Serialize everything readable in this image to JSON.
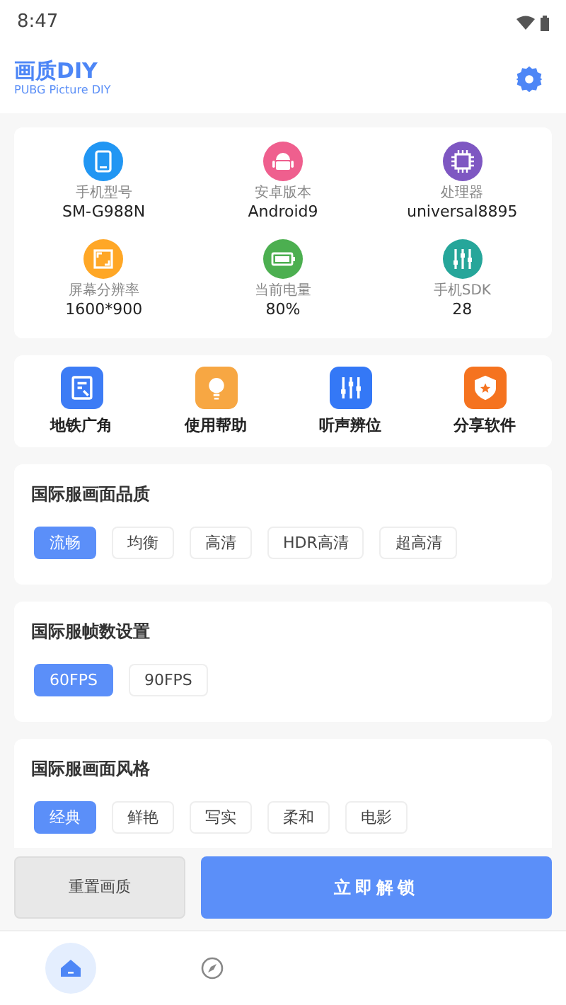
{
  "status_bar": {
    "time": "8:47"
  },
  "header": {
    "title": "画质DIY",
    "subtitle": "PUBG Picture DIY"
  },
  "device_info": [
    {
      "kind": "phone",
      "label": "手机型号",
      "value": "SM-G988N",
      "color": "#2196f3"
    },
    {
      "kind": "android",
      "label": "安卓版本",
      "value": "Android9",
      "color": "#ef5f8e"
    },
    {
      "kind": "chip",
      "label": "处理器",
      "value": "universal8895",
      "color": "#7e57c2"
    },
    {
      "kind": "screen",
      "label": "屏幕分辨率",
      "value": "1600*900",
      "color": "#ffa726"
    },
    {
      "kind": "battery",
      "label": "当前电量",
      "value": "80%",
      "color": "#4caf50"
    },
    {
      "kind": "sliders",
      "label": "手机SDK",
      "value": "28",
      "color": "#26a69a"
    }
  ],
  "tools": [
    {
      "kind": "doc",
      "label": "地铁广角",
      "color": "#3d7cf5"
    },
    {
      "kind": "bulb",
      "label": "使用帮助",
      "color": "#f7a743"
    },
    {
      "kind": "sliders",
      "label": "听声辨位",
      "color": "#3478f6"
    },
    {
      "kind": "shield",
      "label": "分享软件",
      "color": "#f5731f"
    }
  ],
  "sections": [
    {
      "title": "国际服画面品质",
      "options": [
        {
          "label": "流畅",
          "selected": true
        },
        {
          "label": "均衡",
          "selected": false
        },
        {
          "label": "高清",
          "selected": false
        },
        {
          "label": "HDR高清",
          "selected": false
        },
        {
          "label": "超高清",
          "selected": false
        }
      ]
    },
    {
      "title": "国际服帧数设置",
      "options": [
        {
          "label": "60FPS",
          "selected": true
        },
        {
          "label": "90FPS",
          "selected": false
        }
      ]
    },
    {
      "title": "国际服画面风格",
      "options": [
        {
          "label": "经典",
          "selected": true
        },
        {
          "label": "鲜艳",
          "selected": false
        },
        {
          "label": "写实",
          "selected": false
        },
        {
          "label": "柔和",
          "selected": false
        },
        {
          "label": "电影",
          "selected": false
        }
      ]
    }
  ],
  "actions": {
    "reset": "重置画质",
    "unlock": "立即解锁"
  },
  "nav": [
    {
      "kind": "home",
      "selected": true
    },
    {
      "kind": "compass",
      "selected": false
    }
  ]
}
